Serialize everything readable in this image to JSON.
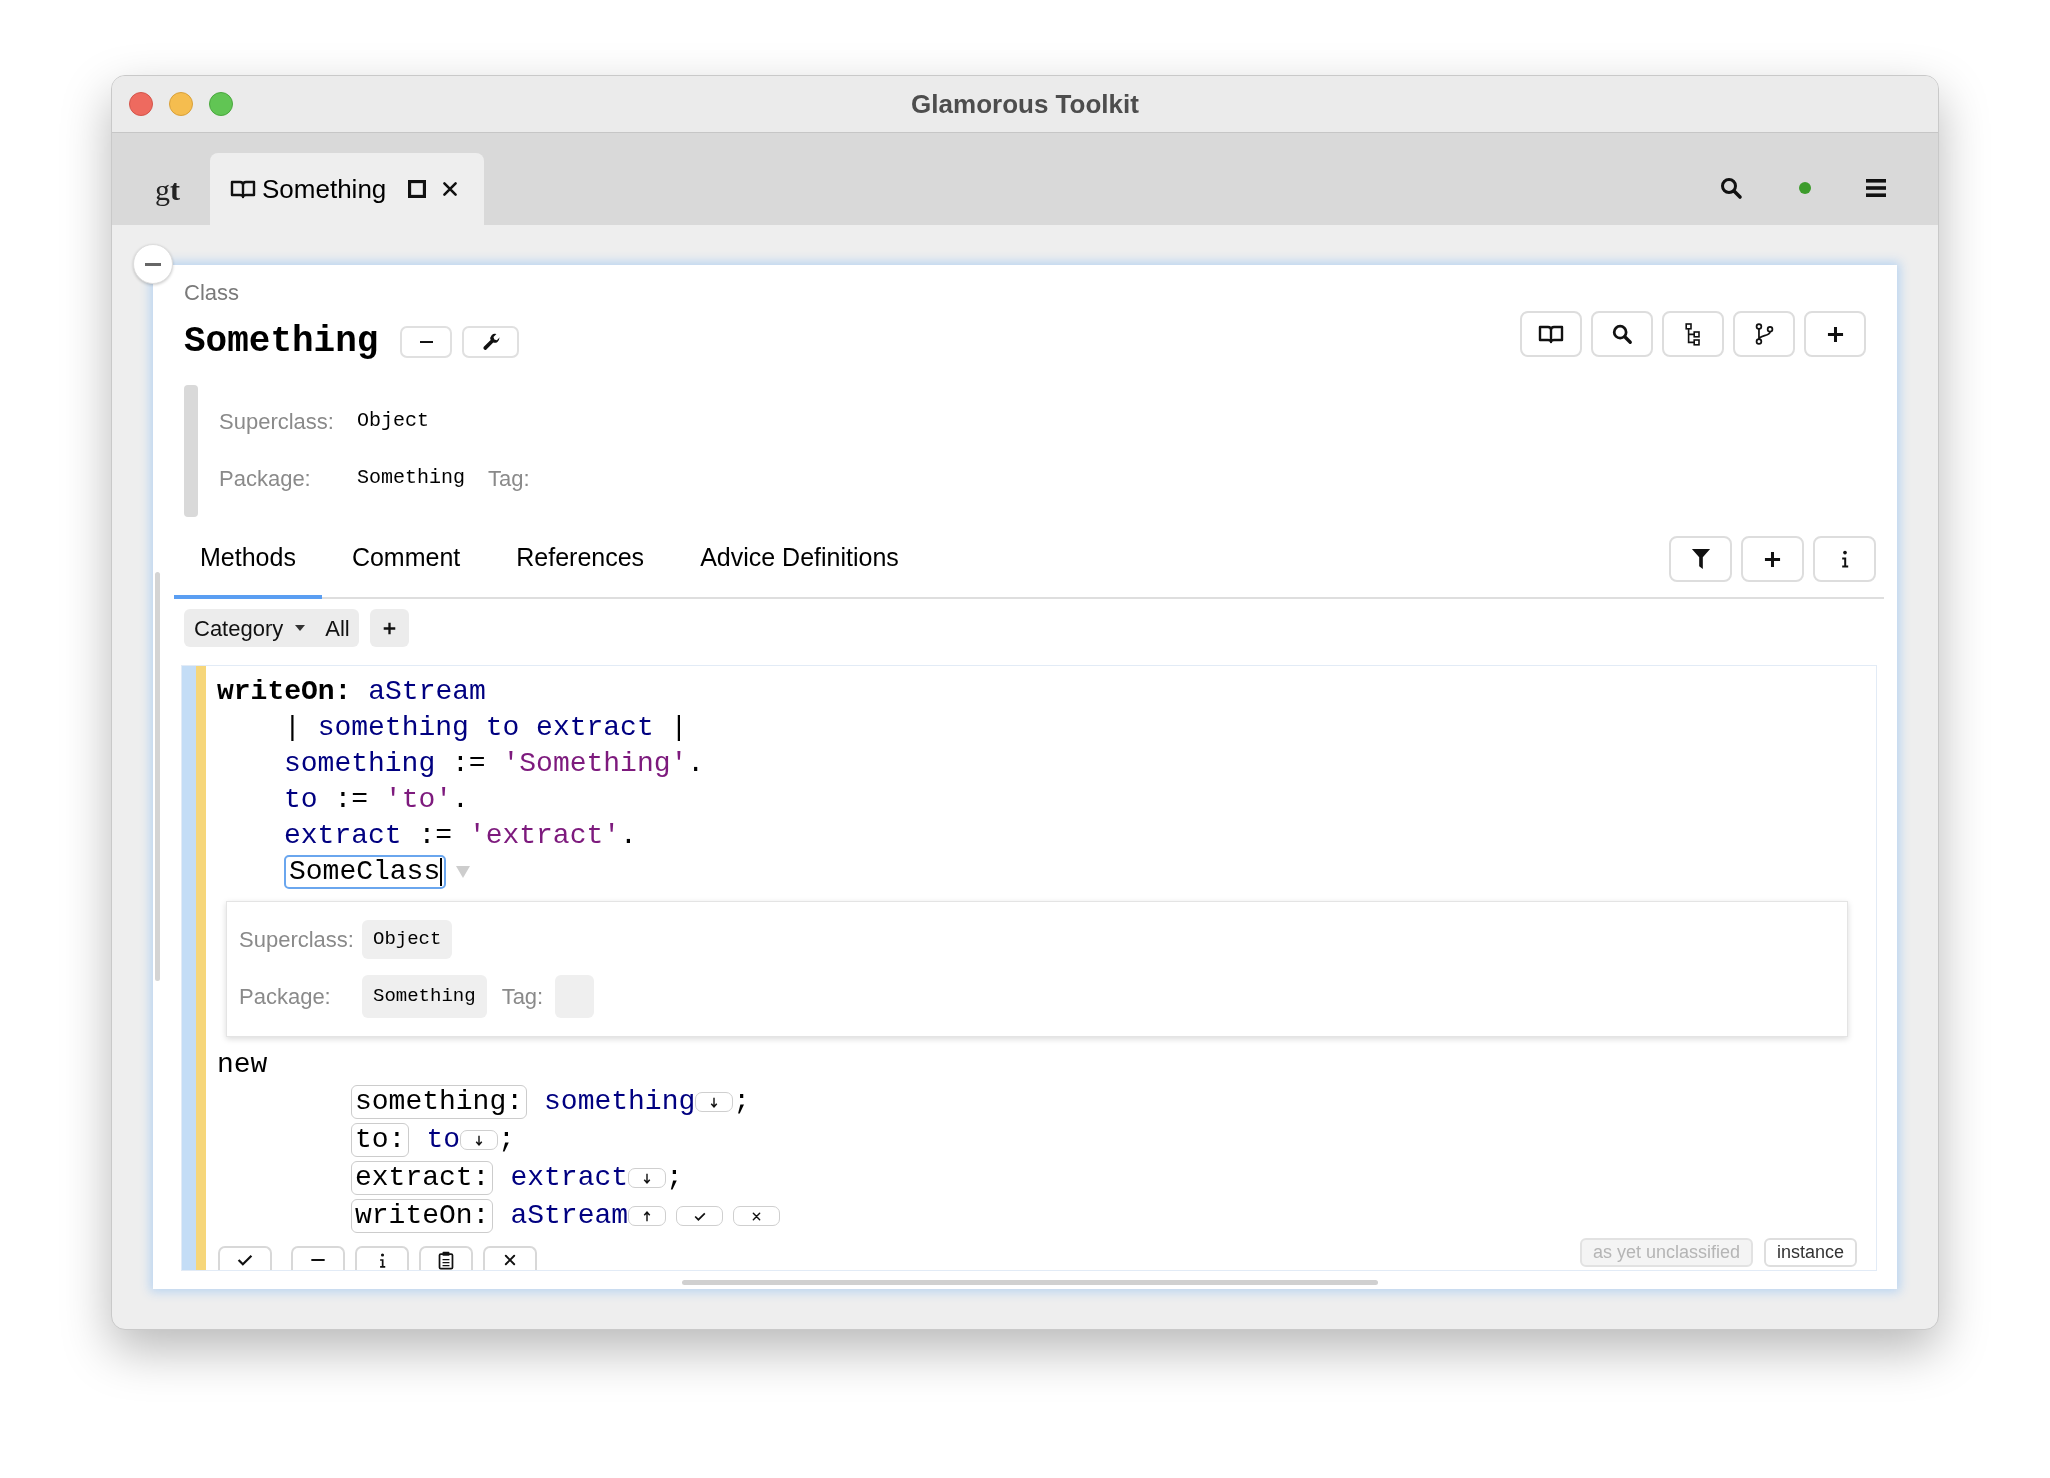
{
  "window": {
    "title": "Glamorous Toolkit"
  },
  "tab_bar": {
    "logo": "g**t**",
    "tabs": [
      {
        "label": "Something",
        "selected": true
      }
    ]
  },
  "class_view": {
    "kind_label": "Class",
    "name": "Something",
    "definition": [
      {
        "label": "Superclass:",
        "value": "Object"
      },
      {
        "label": "Package:",
        "value": "Something",
        "tag_label": "Tag:"
      }
    ],
    "tabs": [
      {
        "label": "Methods",
        "selected": true
      },
      {
        "label": "Comment",
        "selected": false
      },
      {
        "label": "References",
        "selected": false
      },
      {
        "label": "Advice Definitions",
        "selected": false
      }
    ],
    "filter": {
      "category": "Category",
      "scope": "All"
    },
    "method": {
      "lines": [
        {
          "kind": "header",
          "tokens": [
            {
              "kind": "selector",
              "text": "writeOn:"
            },
            {
              "kind": "variable",
              "text": "aStream"
            }
          ]
        },
        {
          "kind": "body",
          "tokens": [
            {
              "kind": "punct",
              "text": "|"
            },
            {
              "kind": "variable",
              "text": "something"
            },
            {
              "kind": "variable",
              "text": "to"
            },
            {
              "kind": "variable",
              "text": "extract"
            },
            {
              "kind": "punct",
              "text": "|"
            }
          ]
        },
        {
          "kind": "body",
          "tokens": [
            {
              "kind": "variable",
              "text": "something"
            },
            {
              "kind": "operator",
              "text": ":="
            },
            {
              "kind": "string",
              "text": "'Something'"
            },
            {
              "kind": "terminator",
              "text": "."
            }
          ]
        },
        {
          "kind": "body",
          "tokens": [
            {
              "kind": "variable",
              "text": "to"
            },
            {
              "kind": "operator",
              "text": ":="
            },
            {
              "kind": "string",
              "text": "'to'"
            },
            {
              "kind": "terminator",
              "text": "."
            }
          ]
        },
        {
          "kind": "body",
          "tokens": [
            {
              "kind": "variable",
              "text": "extract"
            },
            {
              "kind": "operator",
              "text": ":="
            },
            {
              "kind": "string",
              "text": "'extract'"
            },
            {
              "kind": "terminator",
              "text": "."
            }
          ]
        },
        {
          "kind": "body",
          "tokens": [
            {
              "kind": "class_input",
              "text": "SomeClass",
              "expanded": true,
              "popup": [
                {
                  "label": "Superclass:",
                  "value": "Object"
                },
                {
                  "label": "Package:",
                  "value": "Something",
                  "tag_label": "Tag:"
                }
              ]
            }
          ]
        },
        {
          "kind": "header",
          "tokens": [
            {
              "kind": "message",
              "text": "new"
            }
          ]
        },
        {
          "kind": "cascade",
          "tokens": [
            {
              "kind": "keyword",
              "text": "something:"
            },
            {
              "kind": "variable",
              "text": "something"
            },
            {
              "kind": "down_button"
            },
            {
              "kind": "terminator",
              "text": ";"
            }
          ]
        },
        {
          "kind": "cascade",
          "tokens": [
            {
              "kind": "keyword",
              "text": "to:"
            },
            {
              "kind": "variable",
              "text": "to"
            },
            {
              "kind": "down_button"
            },
            {
              "kind": "terminator",
              "text": ";"
            }
          ]
        },
        {
          "kind": "cascade",
          "tokens": [
            {
              "kind": "keyword",
              "text": "extract:"
            },
            {
              "kind": "variable",
              "text": "extract"
            },
            {
              "kind": "down_button"
            },
            {
              "kind": "terminator",
              "text": ";"
            }
          ]
        },
        {
          "kind": "cascade",
          "tokens": [
            {
              "kind": "keyword",
              "text": "writeOn:"
            },
            {
              "kind": "variable",
              "text": "aStream"
            },
            {
              "kind": "up_button"
            },
            {
              "kind": "accept_button"
            },
            {
              "kind": "cancel_button"
            }
          ]
        }
      ],
      "badges": [
        {
          "label": "as yet unclassified",
          "disabled": true
        },
        {
          "label": "instance",
          "disabled": false
        }
      ]
    }
  }
}
